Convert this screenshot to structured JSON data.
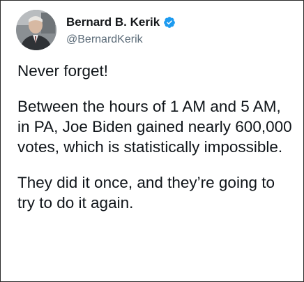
{
  "author": {
    "display_name": "Bernard B. Kerik",
    "handle": "@BernardKerik",
    "verified": true,
    "verified_color": "#1d9bf0",
    "avatar_icon": "profile-photo"
  },
  "tweet": {
    "paragraphs": [
      "Never forget!",
      "Between the hours of 1 AM and 5 AM, in PA, Joe Biden gained nearly 600,000 votes, which is statistically impossible.",
      "They did it once, and they’re going to try to do it again."
    ]
  }
}
